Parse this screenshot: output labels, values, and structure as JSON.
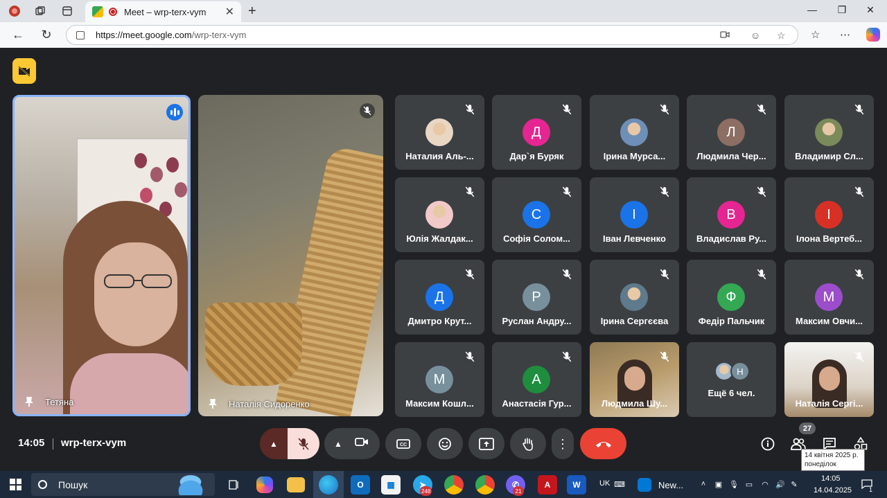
{
  "browser": {
    "tab_title": "Meet – wrp-terx-vym",
    "url_host": "https://meet.google.com",
    "url_path": "/wrp-terx-vym"
  },
  "meet": {
    "pinned": [
      {
        "name": "Тетяна"
      },
      {
        "name": "Наталія Сидоренко"
      }
    ],
    "participants": [
      {
        "name": "Наталия Аль-...",
        "initial": "",
        "color": "#e9d7c4",
        "kind": "photo"
      },
      {
        "name": "Дар`я Буряк",
        "initial": "Д",
        "color": "#e52592",
        "kind": "letter"
      },
      {
        "name": "Ірина Мурса...",
        "initial": "",
        "color": "#6d8fb8",
        "kind": "photo"
      },
      {
        "name": "Людмила Чер...",
        "initial": "Л",
        "color": "#8d6e63",
        "kind": "letter"
      },
      {
        "name": "Владимир Сл...",
        "initial": "",
        "color": "#7a8a5a",
        "kind": "photo"
      },
      {
        "name": "Юлія Жалдак...",
        "initial": "",
        "color": "#f2c9c9",
        "kind": "photo"
      },
      {
        "name": "Софія Солом...",
        "initial": "С",
        "color": "#1a73e8",
        "kind": "letter"
      },
      {
        "name": "Іван Левченко",
        "initial": "І",
        "color": "#1a73e8",
        "kind": "letter"
      },
      {
        "name": "Владислав Ру...",
        "initial": "В",
        "color": "#e52592",
        "kind": "letter"
      },
      {
        "name": "Ілона Вертеб...",
        "initial": "І",
        "color": "#d93025",
        "kind": "letter"
      },
      {
        "name": "Дмитро Крут...",
        "initial": "Д",
        "color": "#1a73e8",
        "kind": "letter"
      },
      {
        "name": "Руслан Андру...",
        "initial": "Р",
        "color": "#78909c",
        "kind": "letter"
      },
      {
        "name": "Ірина Сергєєва",
        "initial": "",
        "color": "#5e7a8c",
        "kind": "photo"
      },
      {
        "name": "Федір Пальчик",
        "initial": "Ф",
        "color": "#34a853",
        "kind": "letter"
      },
      {
        "name": "Максим Овчи...",
        "initial": "М",
        "color": "#9c4dcc",
        "kind": "letter"
      },
      {
        "name": "Максим Кошл...",
        "initial": "М",
        "color": "#78909c",
        "kind": "letter"
      },
      {
        "name": "Анастасія Гур...",
        "initial": "А",
        "color": "#1e8e3e",
        "kind": "letter"
      },
      {
        "name": "Людмила Шу...",
        "initial": "",
        "color": "",
        "kind": "video"
      },
      {
        "name": "Ещё 6 чел.",
        "initial": "Н",
        "color": "#78909c",
        "kind": "more"
      },
      {
        "name": "Наталія Сергі...",
        "initial": "",
        "color": "",
        "kind": "video2"
      }
    ],
    "time": "14:05",
    "meeting_code": "wrp-terx-vym",
    "participants_count": "27",
    "tooltip_line1": "14 квітня 2025 р.",
    "tooltip_line2": "понеділок"
  },
  "taskbar": {
    "search_label": "Пошук",
    "telegram_badge": "248",
    "viber_badge": "21",
    "lang": "UK",
    "news_label": "New...",
    "tray_time": "14:05",
    "tray_date": "14.04.2025",
    "notif_count": "1"
  },
  "colors": {
    "meet_bg": "#202124",
    "tile_bg": "#3c4043",
    "end_call": "#ea4335",
    "active_speaker": "#8ab4f8"
  }
}
